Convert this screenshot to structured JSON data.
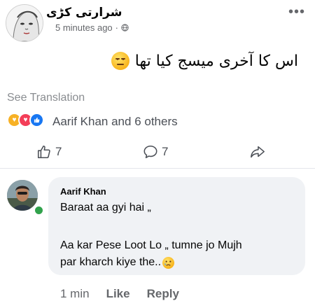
{
  "post": {
    "author": "شرارتی کڑی",
    "time": "5 minutes ago",
    "separator": "·",
    "text": "اس کا آخری میسج کیا تھا",
    "see_translation": "See Translation",
    "reactions_text": "Aarif Khan and 6 others",
    "like_count": "7",
    "comment_count": "7",
    "more_icon": "more-icon",
    "colors": {
      "like": "#1877f2",
      "love": "#f33e58",
      "care": "#f7b125",
      "online": "#31a24c"
    }
  },
  "comment": {
    "author": "Aarif Khan",
    "line1": "Baraat aa gyi hai „",
    "line2": "Aa kar Pese Loot Lo „ tumne jo Mujh",
    "line3": "par kharch kiye the..",
    "time": "1 min",
    "like_label": "Like",
    "reply_label": "Reply"
  }
}
